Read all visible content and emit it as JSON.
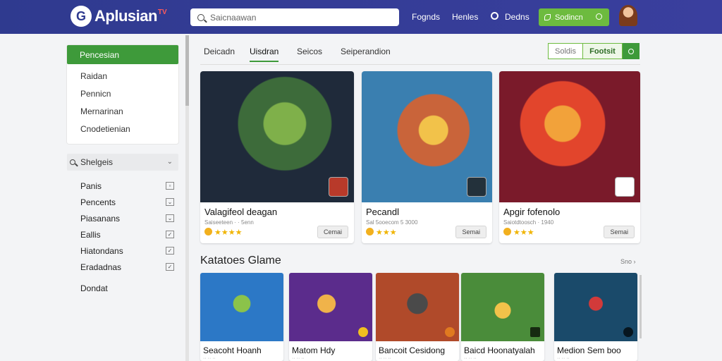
{
  "header": {
    "logo_mark": "G",
    "logo_text": "Aplusian",
    "logo_tag": "TV",
    "search_placeholder": "Saicnaawan",
    "nav": [
      "Fognds",
      "Henles",
      "Dedns"
    ],
    "cta_label": "Sodincn"
  },
  "sidebar": {
    "active": "Pencesian",
    "items": [
      "Raidan",
      "Pennicn",
      "Mernarinan",
      "Cnodetienian"
    ],
    "category_label": "Shelgeis",
    "filters": [
      {
        "label": "Panis",
        "mark": "▫"
      },
      {
        "label": "Pencents",
        "mark": "⌄"
      },
      {
        "label": "Piasanans",
        "mark": "⌄"
      },
      {
        "label": "Eallis",
        "mark": "✓"
      },
      {
        "label": "Hiatondans",
        "mark": "✓"
      },
      {
        "label": "Eradadnas",
        "mark": "✓"
      }
    ],
    "bottom": "Dondat"
  },
  "tabs": [
    "Deicadn",
    "Uisdran",
    "Seicos",
    "Seiperandion"
  ],
  "view_toggle": {
    "left": "Soldis",
    "right": "Footsit"
  },
  "featured": [
    {
      "title": "Valagifeol deagan",
      "sub": "Saiseeteen · · 5enn",
      "stars": "★★★★",
      "button": "Cemai",
      "colors": [
        "#3d6b3a",
        "#1f2a3a",
        "#7fb04a"
      ]
    },
    {
      "title": "Pecandl",
      "sub": "Sal 5ooecom 5 3000",
      "stars": "★★★",
      "button": "Semai",
      "colors": [
        "#c9643a",
        "#3a7fb0",
        "#f2c24a"
      ]
    },
    {
      "title": "Apgir fofenolo",
      "sub": "Saiotdtoosch · 1940",
      "stars": "★★★",
      "button": "Semai",
      "colors": [
        "#e2452c",
        "#7a1a2a",
        "#f2a23a"
      ]
    }
  ],
  "section": {
    "title": "Katatoes Glame",
    "more": "Sno ›"
  },
  "tiles": [
    {
      "title": "Seacoht Hoanh",
      "sub": "·· ·· ··",
      "colors": [
        "#2c78c6",
        "#8bc34a"
      ]
    },
    {
      "title": "Matom Hdy",
      "sub": "·· ·· ··",
      "colors": [
        "#5b2c8c",
        "#f0b34a"
      ]
    },
    {
      "title": "Bancoit Cesidong",
      "sub": "·· ·· ··",
      "colors": [
        "#b04a2a",
        "#4a4a4a"
      ]
    },
    {
      "title": "Baicd Hoonatyalah",
      "sub": "·· ·· ··",
      "colors": [
        "#4a8c3a",
        "#f2c24a"
      ]
    },
    {
      "title": "Medion Sem boo",
      "sub": "·· ·· ··",
      "colors": [
        "#1a4a6a",
        "#d23a3a"
      ]
    }
  ],
  "colors": {
    "brand": "#2f3a8f",
    "accent": "#3e9a3a",
    "cta": "#6dbb3f"
  }
}
